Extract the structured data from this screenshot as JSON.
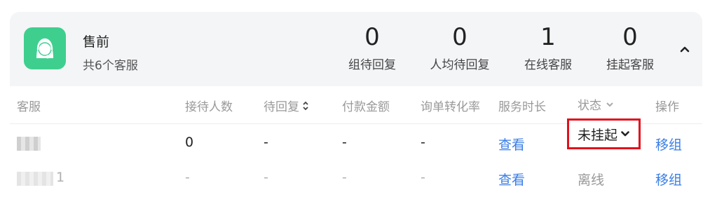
{
  "group": {
    "name": "售前",
    "subtitle": "共6个客服",
    "stats": [
      {
        "value": "0",
        "label": "组待回复"
      },
      {
        "value": "0",
        "label": "人均待回复"
      },
      {
        "value": "1",
        "label": "在线客服"
      },
      {
        "value": "0",
        "label": "挂起客服"
      }
    ],
    "collapse_icon": "chevron-up-icon",
    "avatar_icon": "agent-headset-icon",
    "avatar_color": "#3ecf8e"
  },
  "table": {
    "columns": {
      "agent": "客服",
      "received": "接待人数",
      "pending": "待回复",
      "payment": "付款金额",
      "conversion": "询单转化率",
      "duration": "服务时长",
      "status": "状态",
      "action": "操作"
    },
    "rows": [
      {
        "agent_suffix": "",
        "received": "0",
        "pending": "-",
        "payment": "-",
        "conversion": "-",
        "duration": "查看",
        "status": "未挂起",
        "action": "移组"
      },
      {
        "agent_suffix": "1",
        "received": "-",
        "pending": "-",
        "payment": "-",
        "conversion": "-",
        "duration": "查看",
        "status": "离线",
        "action": "移组"
      }
    ]
  },
  "colors": {
    "link": "#3a7ee6",
    "highlight_border": "#e0101c",
    "header_bg": "#f4f5f7"
  }
}
